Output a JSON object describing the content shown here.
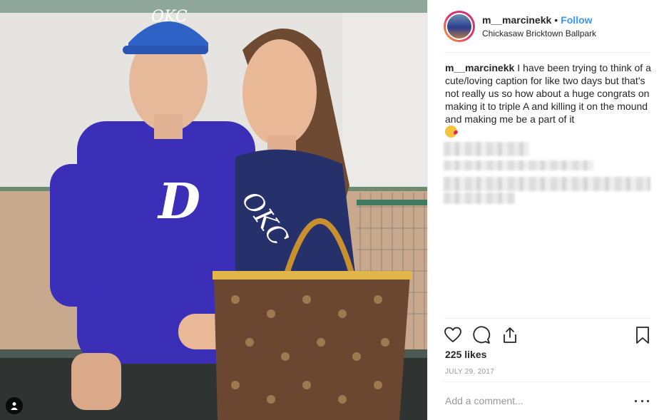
{
  "post": {
    "username": "m__marcinekk",
    "separator": "•",
    "follow_label": "Follow",
    "location": "Chickasaw Bricktown Ballpark"
  },
  "caption": {
    "username": "m__marcinekk",
    "text": "I have been trying to think of a cute/loving caption for like two days but that's not really us so how about a huge congrats on making it to triple A and killing it on the mound and making me be a part of it",
    "emoji": "kissing-heart-emoji"
  },
  "photo": {
    "cap_text": "OKC",
    "jersey_letter": "D",
    "shirt_text": "OKC"
  },
  "icons": {
    "like": "heart-icon",
    "comment": "comment-icon",
    "share": "share-icon",
    "save": "bookmark-icon",
    "tag": "user-tag-icon",
    "more": "more-options-icon"
  },
  "stats": {
    "likes": "225 likes",
    "date": "JULY 29, 2017"
  },
  "comment": {
    "placeholder": "Add a comment..."
  },
  "colors": {
    "follow": "#3897f0",
    "text": "#262626",
    "muted": "#999999",
    "jersey": "#3b2fb8"
  }
}
